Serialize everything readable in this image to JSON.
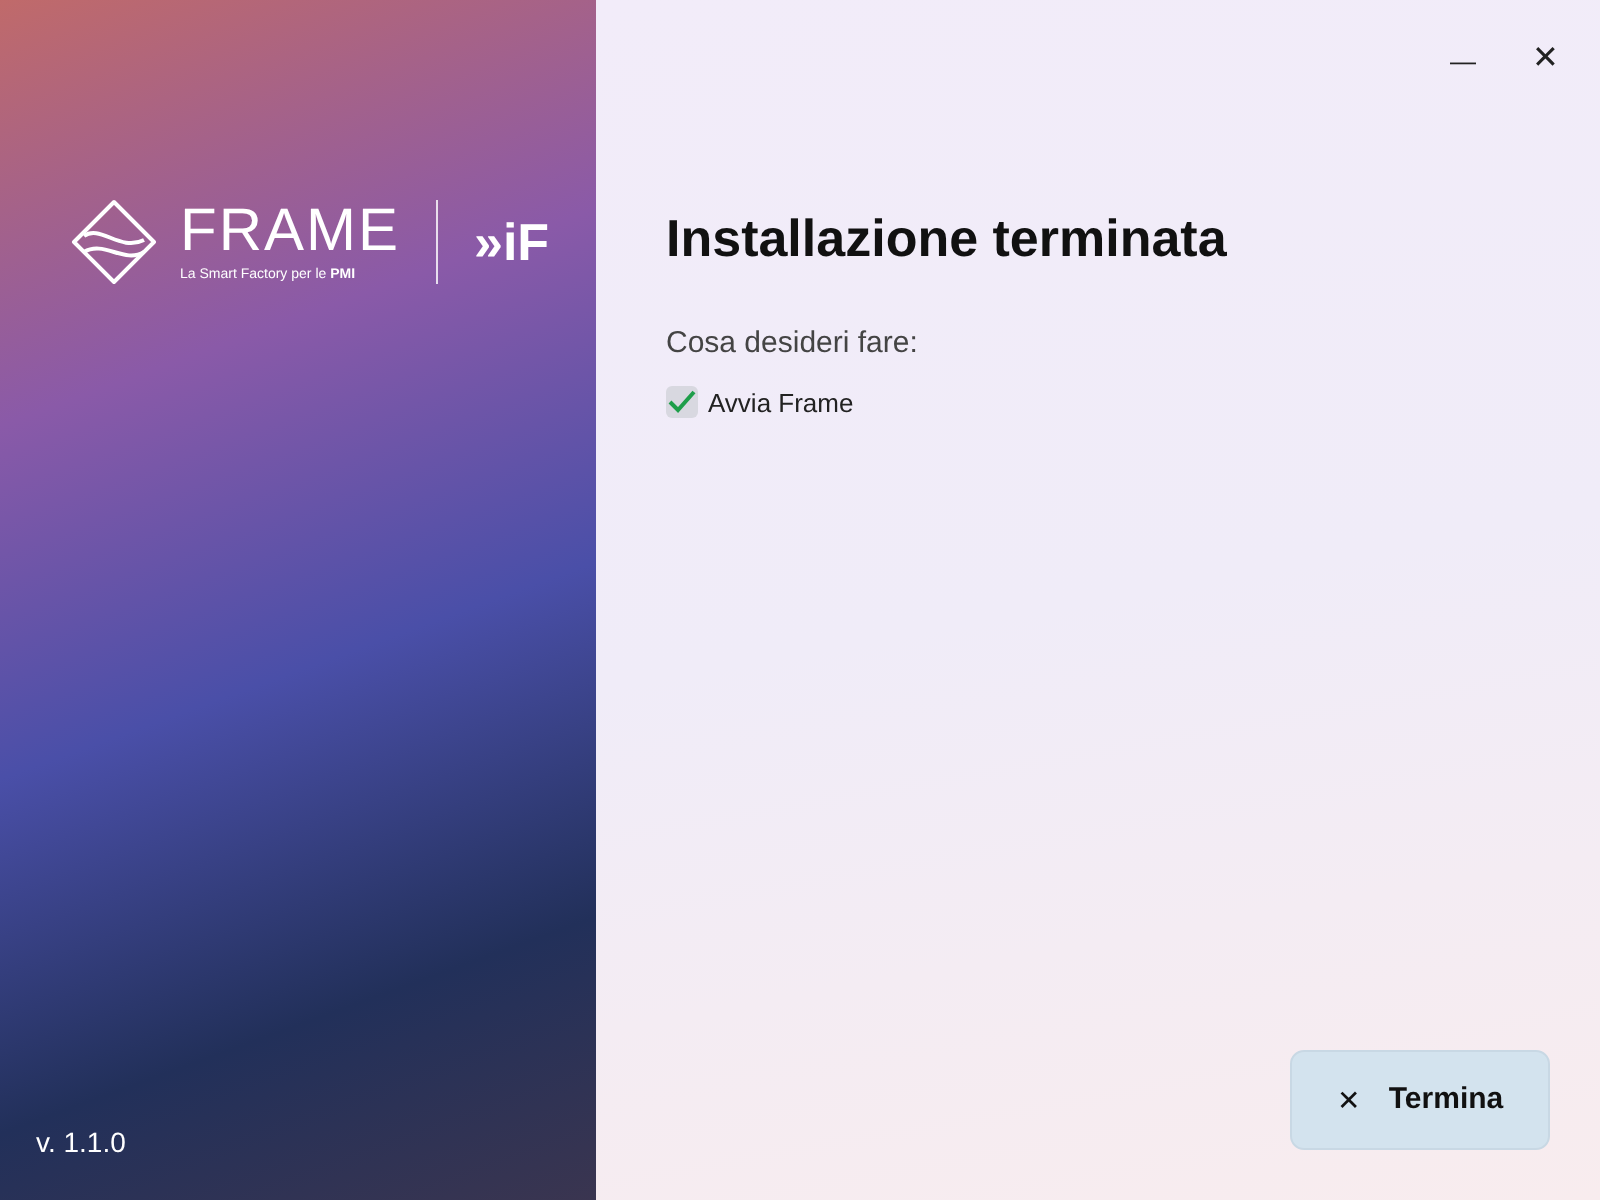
{
  "sidebar": {
    "logo_wordmark": "FRAME",
    "logo_tagline": "La Smart Factory per le **PMI**",
    "partner_logo": "»iF",
    "version": "v. 1.1.0"
  },
  "title_bar": {
    "minimize": "—",
    "close": "✕"
  },
  "title": "Installazione terminata",
  "prompt": "Cosa desideri fare:",
  "options": [
    {
      "label": "Avvia Frame",
      "checked": true
    }
  ],
  "button": {
    "icon": "✕",
    "label": "Termina"
  }
}
